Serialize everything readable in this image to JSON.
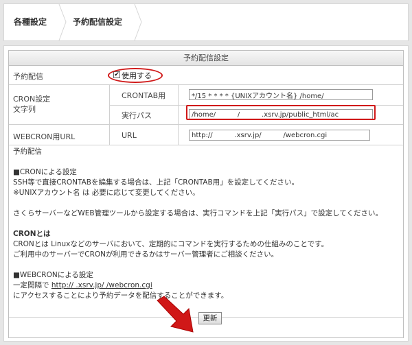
{
  "breadcrumb": {
    "item1": "各種設定",
    "item2": "予約配信設定"
  },
  "table": {
    "title": "予約配信設定",
    "row_schedule": {
      "label": "予約配信",
      "checkbox_label": "使用する",
      "checked": true
    },
    "row_cron": {
      "label_line1": "CRON設定",
      "label_line2": "文字列",
      "crontab_label": "CRONTAB用",
      "crontab_value": "*/15 * * * * {UNIXアカウント名} /home/",
      "exec_label": "実行パス",
      "exec_value": "/home/          /          .xsrv.jp/public_html/ac"
    },
    "row_webcron": {
      "label": "WEBCRON用URL",
      "url_label": "URL",
      "url_value": "http://          .xsrv.jp/          /webcron.cgi"
    }
  },
  "description": {
    "heading": "予約配信",
    "cron_heading": "■CRONによる設定",
    "cron_line1": "SSH等で直接CRONTABを編集する場合は、上記「CRONTAB用」を設定してください。",
    "cron_line2": "※UNIXアカウント名 は 必要に応じて変更してください。",
    "sakura_line": "さくらサーバーなどWEB管理ツールから設定する場合は、実行コマンドを上記「実行パス」で設定してください。",
    "what_heading": "CRONとは",
    "what_line1": "CRONとは Linuxなどのサーバにおいて、定期的にコマンドを実行するための仕組みのことです。",
    "what_line2": "ご利用中のサーバーでCRONが利用できるかはサーバー管理者にご相談ください。",
    "webcron_heading": "■WEBCRONによる設定",
    "webcron_prefix": "一定間隔で",
    "webcron_url": "http://          .xsrv.jp/          /webcron.cgi",
    "webcron_line2": "にアクセスすることにより予約データを配信することができます。"
  },
  "buttons": {
    "update": "更新"
  },
  "colors": {
    "highlight": "#d01818",
    "background": "#e6e6e6"
  }
}
